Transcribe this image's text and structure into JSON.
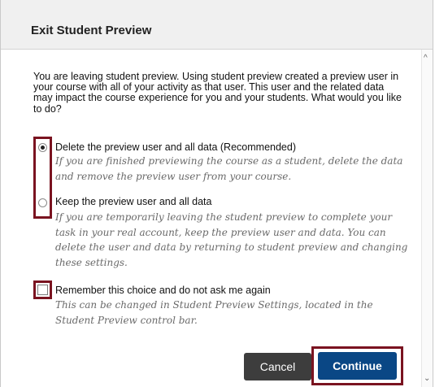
{
  "dialog": {
    "title": "Exit Student Preview",
    "intro": "You are leaving student preview. Using student preview created a preview user in your course with all of your activity as that user. This user and the related data may impact the course experience for you and your students. What would you like to do?",
    "options": [
      {
        "label": "Delete the preview user and all data (Recommended)",
        "description": "If you are finished previewing the course as a student, delete the data and remove the preview user from your course.",
        "selected": true
      },
      {
        "label": "Keep the preview user and all data",
        "description": "If you are temporarily leaving the student preview to complete your task in your real account, keep the preview user and data. You can delete the user and data by returning to student preview and changing these settings.",
        "selected": false
      }
    ],
    "remember": {
      "label": "Remember this choice and do not ask me again",
      "description": "This can be changed in Student Preview Settings, located in the Student Preview control bar.",
      "checked": false
    },
    "buttons": {
      "cancel": "Cancel",
      "continue": "Continue"
    }
  },
  "icons": {
    "scroll_up": "scroll-up-arrow-icon",
    "scroll_down": "scroll-down-arrow-icon"
  },
  "colors": {
    "highlight": "#7a1320",
    "primary_button": "#0a4785",
    "secondary_button": "#3d3d3d"
  }
}
